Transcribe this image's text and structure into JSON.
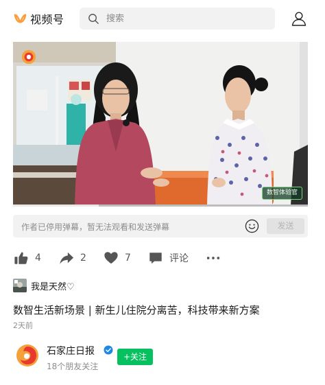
{
  "header": {
    "app_name": "视频号",
    "search_placeholder": "搜索",
    "brand_color": "#fa9d3b"
  },
  "video": {
    "overlay_badge": "数智体验官",
    "progress": 0.29
  },
  "danmu": {
    "notice": "作者已停用弹幕，暂无法观看和发送弹幕",
    "send_label": "发送"
  },
  "actions": {
    "likes": "4",
    "forwards": "2",
    "favorites": "7",
    "comment_label": "评论"
  },
  "author": {
    "name": "我是天然♡"
  },
  "post": {
    "title": "数智生活新场景 | 新生儿住院分离苦，科技带来新方案",
    "time": "2天前"
  },
  "account": {
    "name": "石家庄日报",
    "subtitle": "18个朋友关注",
    "follow_label": "+关注",
    "follow_color": "#07c160"
  }
}
